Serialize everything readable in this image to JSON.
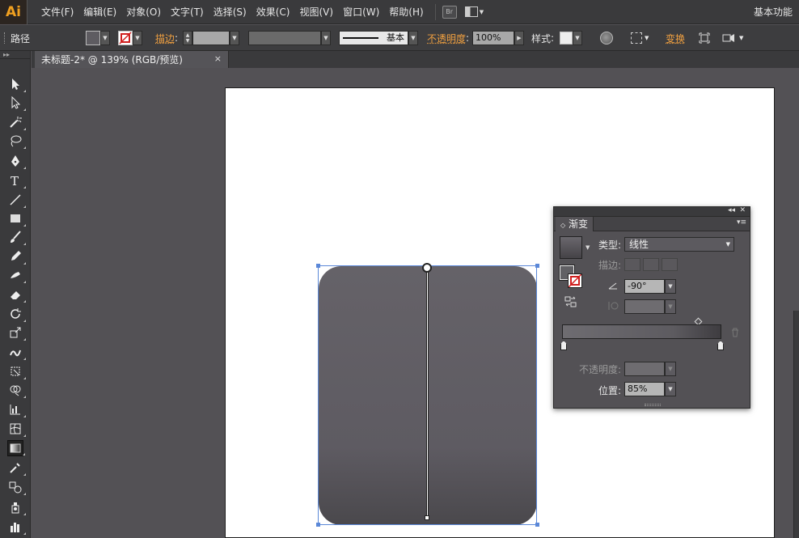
{
  "app": {
    "logo": "Ai",
    "workspace": "基本功能"
  },
  "menu": [
    "文件(F)",
    "编辑(E)",
    "对象(O)",
    "文字(T)",
    "选择(S)",
    "效果(C)",
    "视图(V)",
    "窗口(W)",
    "帮助(H)"
  ],
  "menubar_icons": {
    "bridge": "Br"
  },
  "control": {
    "selection_type": "路径",
    "stroke_label": "描边",
    "stroke_profile": "基本",
    "opacity_label": "不透明度",
    "opacity_value": "100%",
    "style_label": "样式",
    "transform_label": "变换"
  },
  "document_tab": {
    "title": "未标题-2* @ 139% (RGB/预览)",
    "close": "×"
  },
  "tools": [
    "selection-tool-icon",
    "direct-selection-tool-icon",
    "magic-wand-icon",
    "lasso-icon",
    "pen-icon",
    "type-icon",
    "line-icon",
    "rectangle-icon",
    "paintbrush-icon",
    "pencil-icon",
    "blob-brush-icon",
    "eraser-icon",
    "rotate-icon",
    "scale-icon",
    "warp-icon",
    "free-transform-icon",
    "shape-builder-icon",
    "graph-icon",
    "mesh-icon",
    "gradient-tool-icon",
    "eyedropper-icon",
    "blend-icon",
    "symbol-sprayer-icon",
    "column-graph-icon"
  ],
  "gradient_panel": {
    "title": "渐变",
    "type_label": "类型",
    "type_value": "线性",
    "stroke_label": "描边",
    "angle_value": "-90°",
    "opacity_label": "不透明度",
    "location_label": "位置",
    "location_value": "85%",
    "collapse": "◂◂",
    "close": "✕",
    "menu": "▾≡",
    "stops": [
      {
        "location_percent": 0
      },
      {
        "location_percent": 100
      }
    ],
    "midpoint_percent": 84
  },
  "colors": {
    "shape_top": "#656268",
    "shape_bottom": "#4a484c",
    "selection_blue": "#5b88d8",
    "accent_orange": "#f0a040"
  }
}
